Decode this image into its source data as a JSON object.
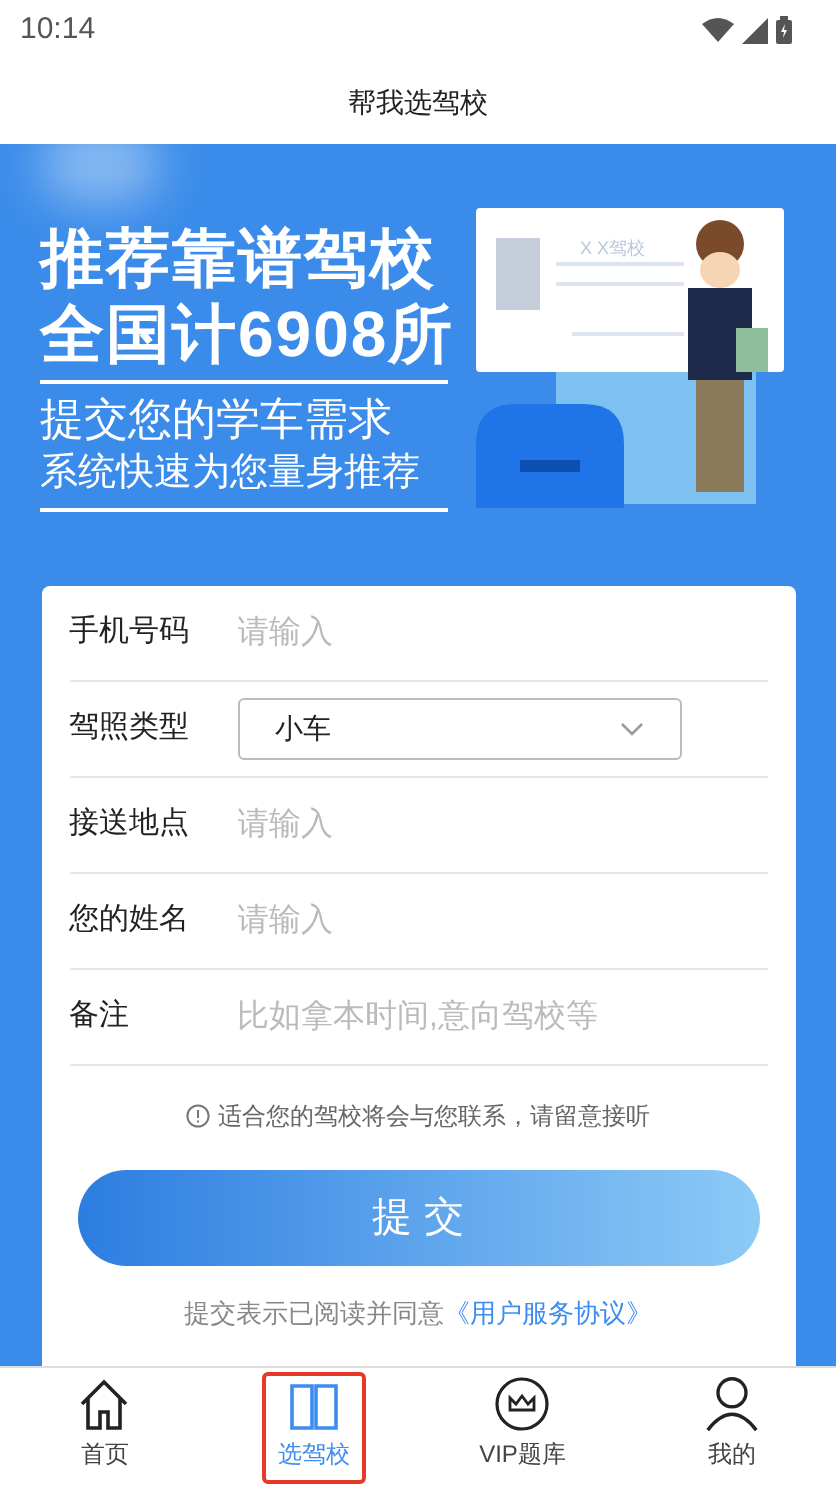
{
  "status_bar": {
    "time": "10:14"
  },
  "header": {
    "title": "帮我选驾校"
  },
  "banner": {
    "headline": [
      "推荐靠谱驾校",
      "全国计6908所"
    ],
    "sublines": [
      "提交您的学车需求",
      "系统快速为您量身推荐"
    ],
    "card_label": "X X驾校"
  },
  "form": {
    "fields": [
      {
        "kind": "text",
        "label": "手机号码",
        "placeholder": "请输入"
      },
      {
        "kind": "select",
        "label": "驾照类型",
        "value": "小车"
      },
      {
        "kind": "text",
        "label": "接送地点",
        "placeholder": "请输入"
      },
      {
        "kind": "text",
        "label": "您的姓名",
        "placeholder": "请输入"
      },
      {
        "kind": "text",
        "label": "备注",
        "placeholder": "比如拿本时间,意向驾校等"
      }
    ],
    "notice": "适合您的驾校将会与您联系，请留意接听",
    "submit": "提 交",
    "agreement": "提交表示已阅读并同意",
    "agreement_link": "《用户服务协议》"
  },
  "tabs": [
    {
      "label": "首页",
      "kind": "home",
      "selected": false
    },
    {
      "label": "选驾校",
      "kind": "book",
      "selected": true
    },
    {
      "label": "VIP题库",
      "kind": "crown",
      "selected": false
    },
    {
      "label": "我的",
      "kind": "person",
      "selected": false
    }
  ]
}
